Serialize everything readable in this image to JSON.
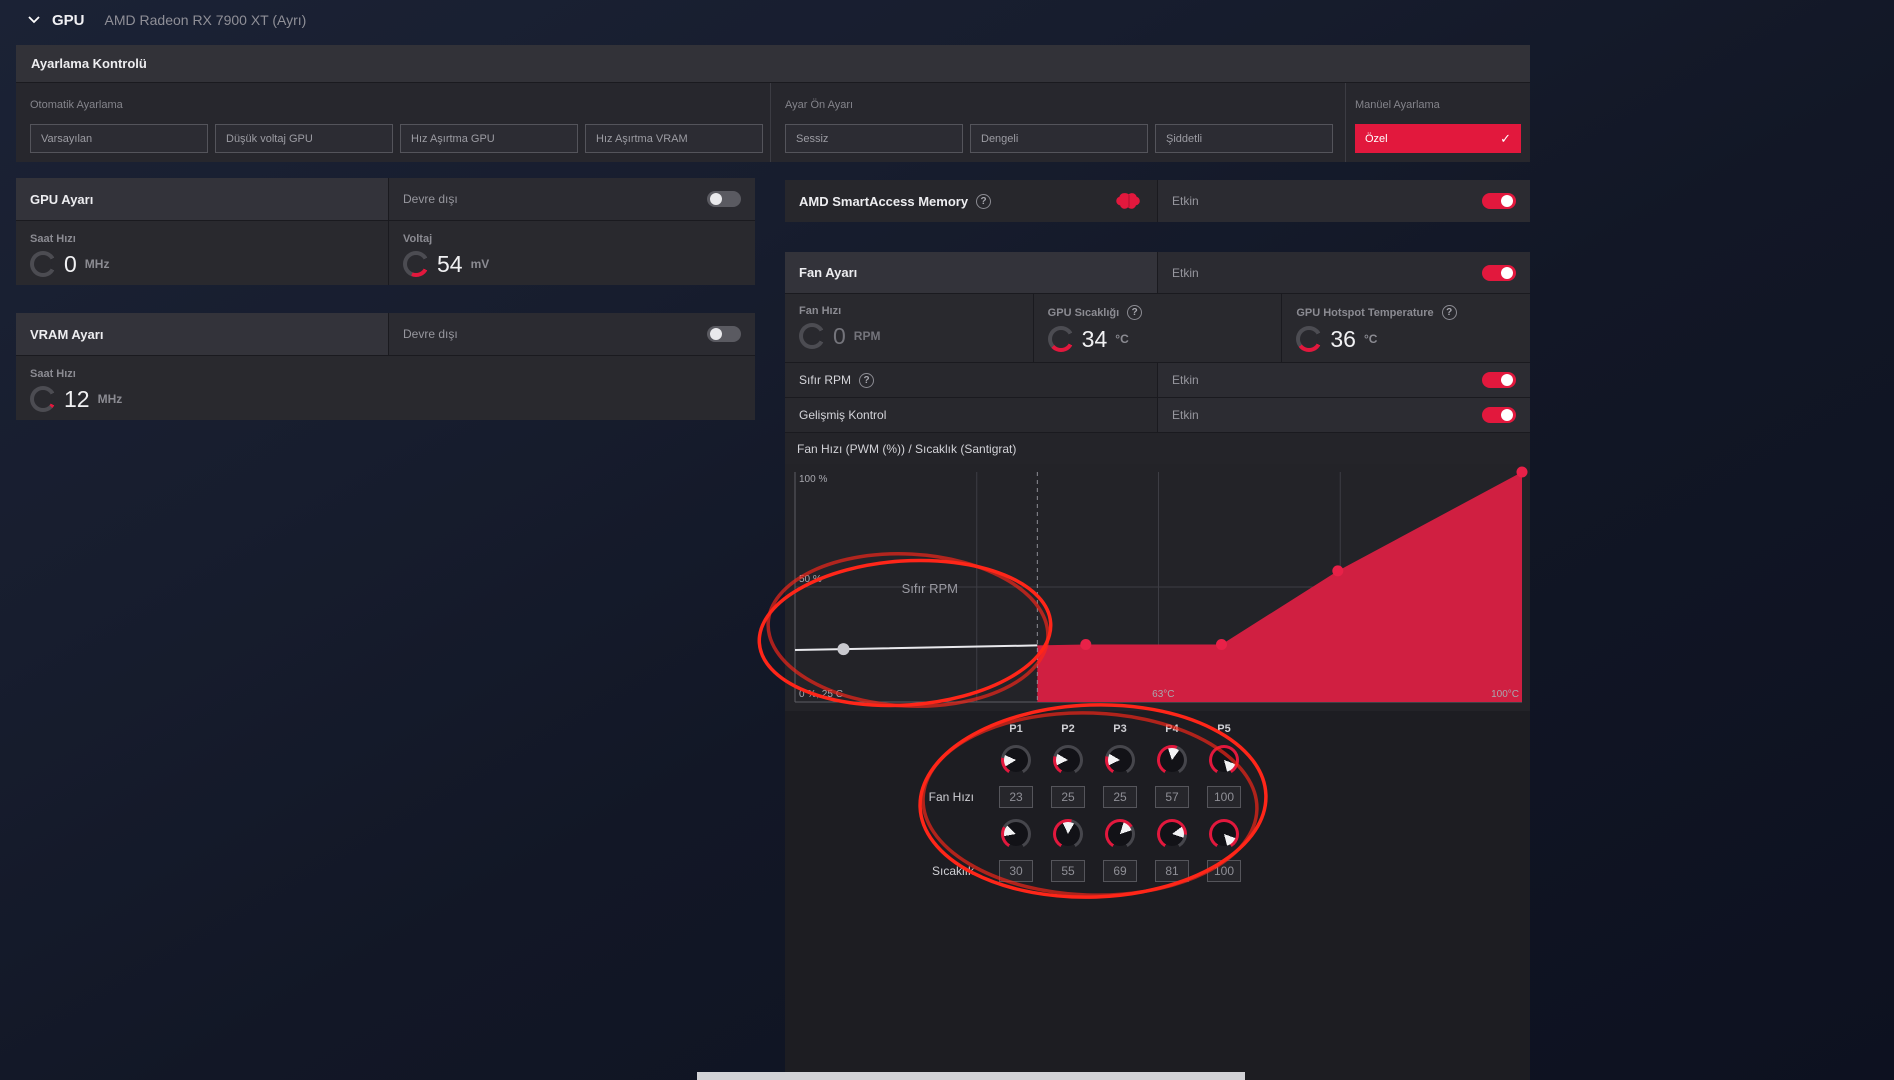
{
  "colors": {
    "accent": "#e2183d",
    "annotation": "#ff2619",
    "chart_area": "#d01f41",
    "chart_point": "#e82148"
  },
  "icons": {
    "check": "✓",
    "help": "?"
  },
  "header": {
    "section_label": "GPU",
    "device_name": "AMD Radeon RX 7900 XT (Ayrı)"
  },
  "tuning_control": {
    "title": "Ayarlama Kontrolü",
    "auto": {
      "label": "Otomatik Ayarlama",
      "buttons": [
        "Varsayılan",
        "Düşük voltaj GPU",
        "Hız Aşırtma GPU",
        "Hız Aşırtma VRAM"
      ]
    },
    "preset": {
      "label": "Ayar Ön Ayarı",
      "buttons": [
        "Sessiz",
        "Dengeli",
        "Şiddetli"
      ]
    },
    "manual": {
      "label": "Manüel Ayarlama",
      "button": "Özel"
    }
  },
  "gpu_tuning": {
    "title": "GPU Ayarı",
    "status": "Devre dışı",
    "clock": {
      "label": "Saat Hızı",
      "value": "0",
      "unit": "MHz"
    },
    "voltage": {
      "label": "Voltaj",
      "value": "54",
      "unit": "mV"
    }
  },
  "vram_tuning": {
    "title": "VRAM Ayarı",
    "status": "Devre dışı",
    "clock": {
      "label": "Saat Hızı",
      "value": "12",
      "unit": "MHz"
    }
  },
  "smart_access_memory": {
    "title": "AMD SmartAccess Memory",
    "status": "Etkin"
  },
  "fan_tuning": {
    "title": "Fan Ayarı",
    "status": "Etkin",
    "fan_speed": {
      "label": "Fan Hızı",
      "value": "0",
      "unit": "RPM"
    },
    "gpu_temp": {
      "label": "GPU Sıcaklığı",
      "value": "34",
      "unit": "°C"
    },
    "hotspot_temp": {
      "label": "GPU Hotspot Temperature",
      "value": "36",
      "unit": "°C"
    },
    "zero_rpm": {
      "label": "Sıfır RPM",
      "status": "Etkin"
    },
    "advanced": {
      "label": "Gelişmiş Kontrol",
      "status": "Etkin"
    }
  },
  "fan_curve": {
    "title": "Fan Hızı (PWM (%)) / Sıcaklık (Santigrat)",
    "overlay_label": "Sıfır RPM",
    "chart_data": {
      "type": "area",
      "x_unit": "°C",
      "y_unit": "%",
      "xlim": [
        25,
        100
      ],
      "ylim": [
        0,
        100
      ],
      "points": [
        {
          "temp": 30,
          "fan": 23
        },
        {
          "temp": 55,
          "fan": 25
        },
        {
          "temp": 69,
          "fan": 25
        },
        {
          "temp": 81,
          "fan": 57
        },
        {
          "temp": 100,
          "fan": 100
        }
      ],
      "zero_rpm_boundary_temp": 50,
      "axis_labels": {
        "top_left": "100 %",
        "mid_left": "50 %",
        "bottom_left": "0 %, 25 C",
        "bottom_mid": "63°C",
        "bottom_right": "100°C"
      },
      "grid": true,
      "legend": false
    }
  },
  "fan_points": {
    "column_labels": [
      "P1",
      "P2",
      "P3",
      "P4",
      "P5"
    ],
    "fan_row_label": "Fan Hızı",
    "temp_row_label": "Sıcaklık",
    "fan_values": [
      23,
      25,
      25,
      57,
      100
    ],
    "temp_values": [
      30,
      55,
      69,
      81,
      100
    ]
  }
}
